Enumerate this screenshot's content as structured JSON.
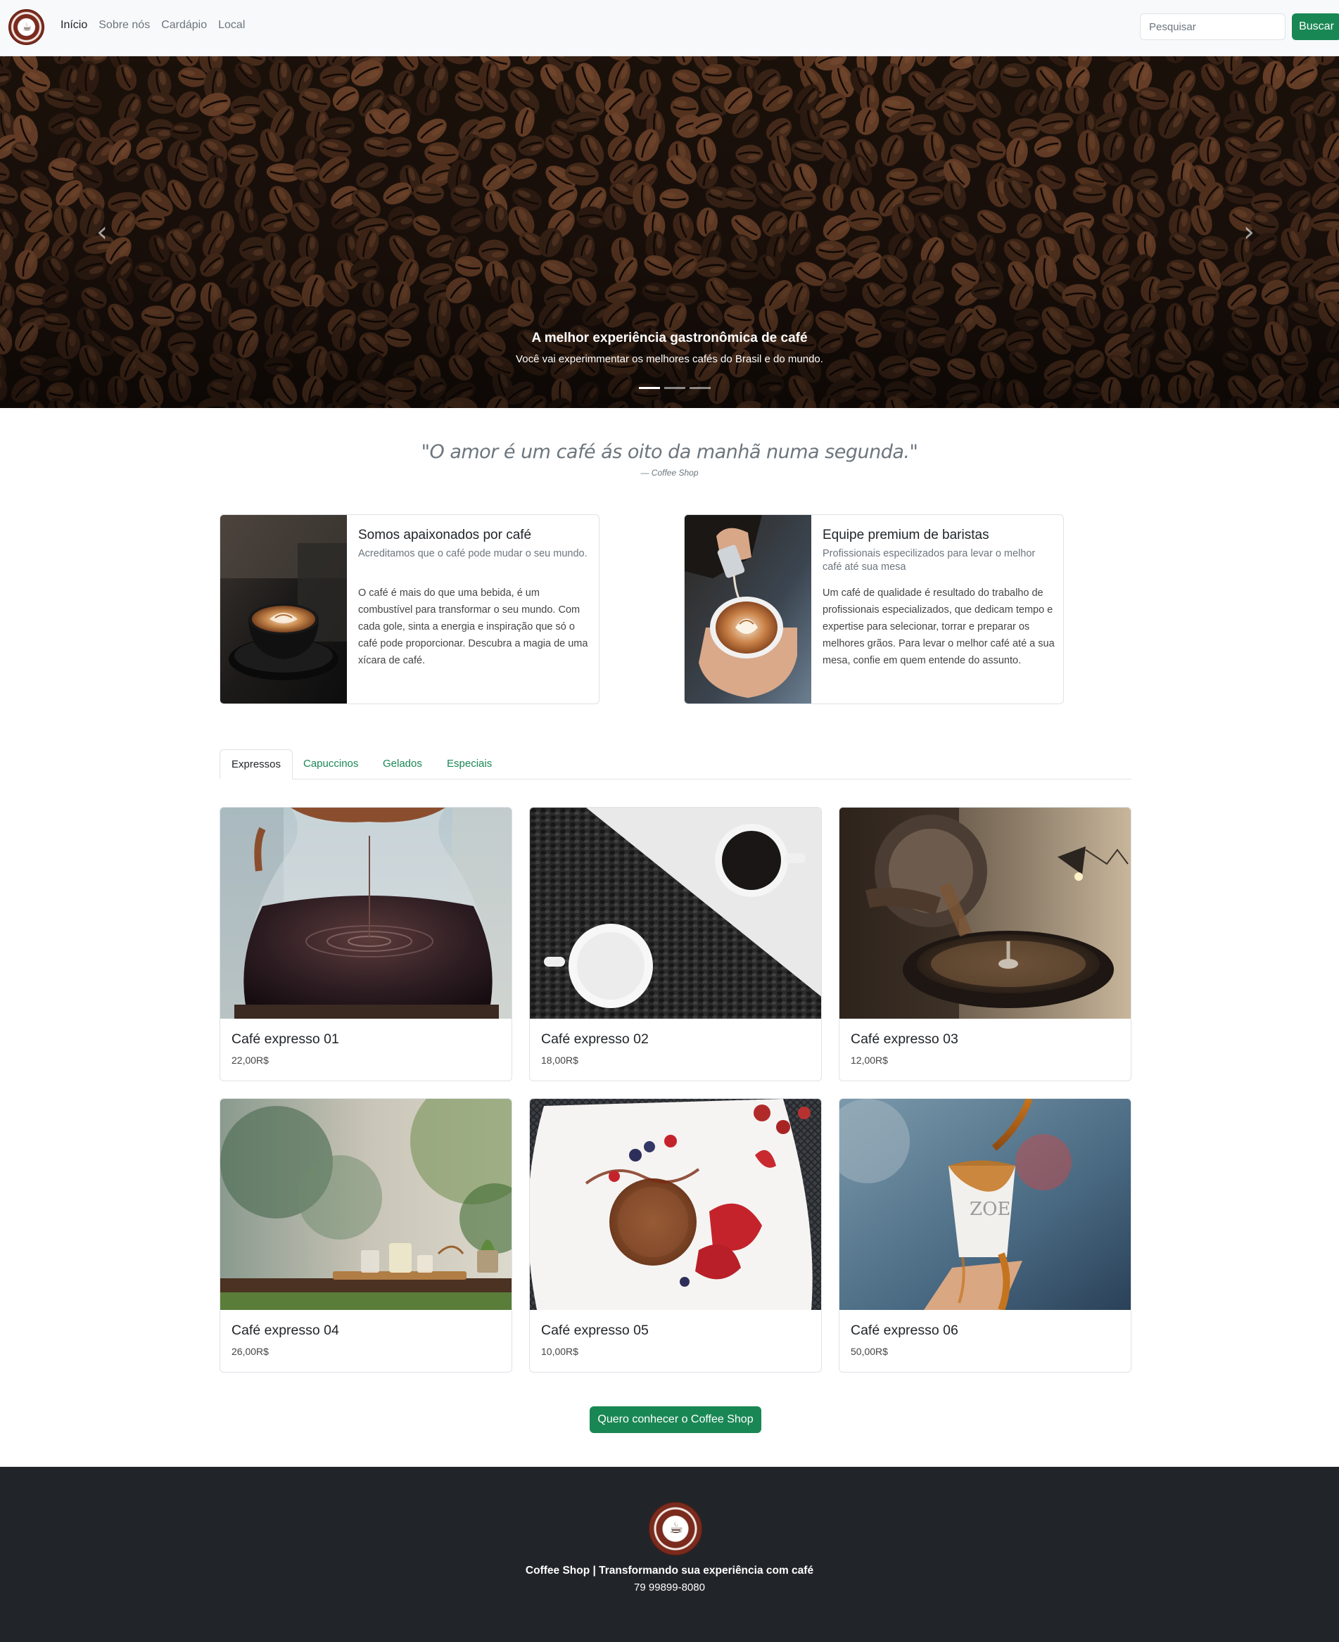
{
  "navbar": {
    "links": [
      "Início",
      "Sobre nós",
      "Cardápio",
      "Local"
    ],
    "active_index": 0,
    "search_placeholder": "Pesquisar",
    "search_button": "Buscar"
  },
  "carousel": {
    "title": "A melhor experiência gastronômica de café",
    "subtitle": "Você vai experimmentar os melhores cafés do Brasil e do mundo.",
    "slide_count": 3,
    "active_slide": 0
  },
  "quote": {
    "text": "\"O amor é um café ás oito da manhã numa segunda.\"",
    "author": "— Coffee Shop"
  },
  "about": [
    {
      "title": "Somos apaixonados por café",
      "subtitle": "Acreditamos que o café pode mudar o seu mundo.",
      "text": "O café é mais do que uma bebida, é um combustível para transformar o seu mundo. Com cada gole, sinta a energia e inspiração que só o café pode proporcionar. Descubra a magia de uma xícara de café."
    },
    {
      "title": "Equipe premium de baristas",
      "subtitle": "Profissionais especilizados para levar o melhor café até sua mesa",
      "text": "Um café de qualidade é resultado do trabalho de profissionais especializados, que dedicam tempo e expertise para selecionar, torrar e preparar os melhores grãos. Para levar o melhor café até a sua mesa, confie em quem entende do assunto."
    }
  ],
  "tabs": [
    "Expressos",
    "Capuccinos",
    "Gelados",
    "Especiais"
  ],
  "active_tab": 0,
  "products": [
    {
      "name": "Café expresso 01",
      "price": "22,00R$"
    },
    {
      "name": "Café expresso 02",
      "price": "18,00R$"
    },
    {
      "name": "Café expresso 03",
      "price": "12,00R$"
    },
    {
      "name": "Café expresso 04",
      "price": "26,00R$"
    },
    {
      "name": "Café expresso 05",
      "price": "10,00R$"
    },
    {
      "name": "Café expresso 06",
      "price": "50,00R$"
    }
  ],
  "cta_label": "Quero conhecer o Coffee Shop",
  "footer": {
    "title": "Coffee Shop | Transformando sua experiência com café",
    "phone": "79 99899-8080"
  },
  "colors": {
    "brand_green": "#198754",
    "footer_bg": "#212529",
    "navbar_bg": "#f8f9fa",
    "logo_brown": "#7a2b1e"
  }
}
